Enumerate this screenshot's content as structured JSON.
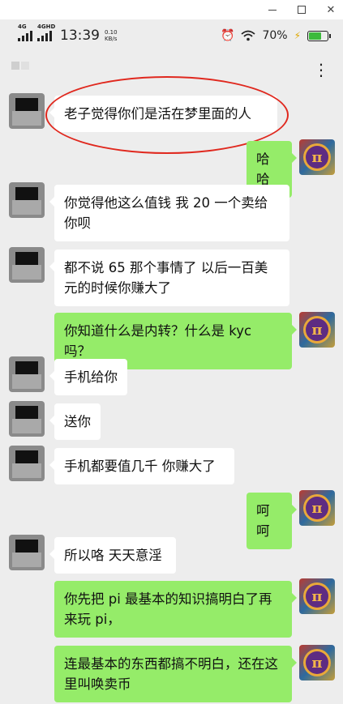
{
  "status_bar": {
    "network_1": "4G",
    "network_2": "4GHD",
    "time": "13:39",
    "speed_value": "0.10",
    "speed_unit": "KB/s",
    "battery": "70%",
    "battery_level": 0.7
  },
  "header": {
    "more_icon": "⋮"
  },
  "messages": [
    {
      "from": "other",
      "text": "老子觉得你们是活在梦里面的人"
    },
    {
      "from": "self",
      "text": "哈哈"
    },
    {
      "from": "other",
      "text": "你觉得他这么值钱  我 20 一个卖给你呗"
    },
    {
      "from": "other",
      "text": "都不说 65 那个事情了 以后一百美元的时候你赚大了"
    },
    {
      "from": "self",
      "text": "你知道什么是内转？什么是 kyc 吗？"
    },
    {
      "from": "other",
      "text": "手机给你"
    },
    {
      "from": "other",
      "text": "送你"
    },
    {
      "from": "other",
      "text": "手机都要值几千 你赚大了"
    },
    {
      "from": "self",
      "text": "呵呵"
    },
    {
      "from": "other",
      "text": "所以咯 天天意淫"
    },
    {
      "from": "self",
      "text": "你先把 pi 最基本的知识搞明白了再来玩 pi，"
    },
    {
      "from": "self",
      "text": "连最基本的东西都搞不明白，还在这里叫唤卖币"
    }
  ],
  "self_avatar_glyph": "π",
  "colors": {
    "self_bubble": "#95ec69",
    "other_bubble": "#ffffff",
    "background": "#ededed",
    "highlight_circle": "#e0281e"
  }
}
